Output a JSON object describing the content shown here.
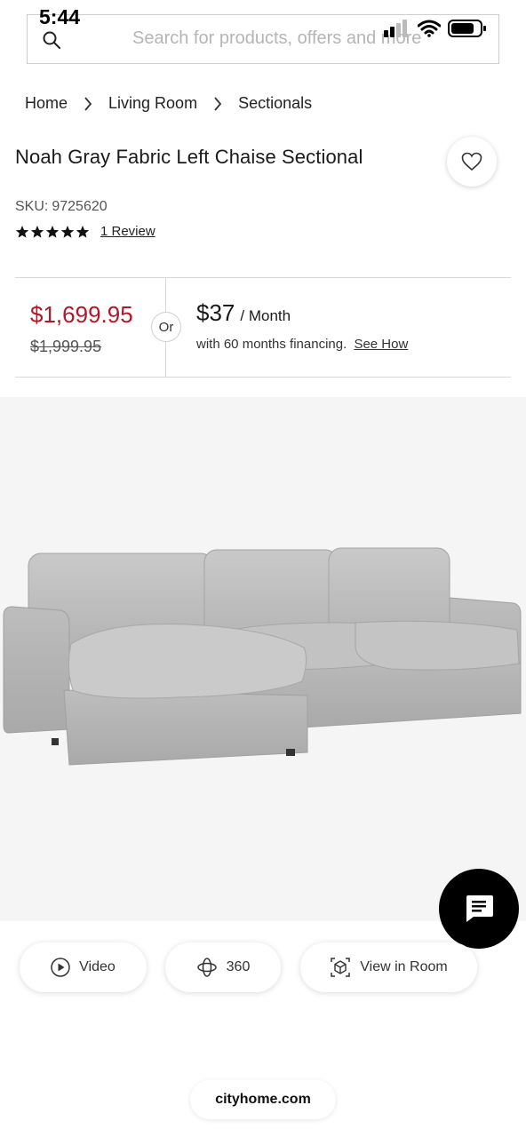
{
  "status_bar": {
    "time": "5:44"
  },
  "search": {
    "placeholder": "Search for products, offers and more"
  },
  "breadcrumb": [
    "Home",
    "Living Room",
    "Sectionals"
  ],
  "product": {
    "title": "Noah Gray Fabric Left Chaise Sectional",
    "sku_label": "SKU:",
    "sku": "9725620",
    "rating_stars": 5,
    "review_link": "1 Review"
  },
  "pricing": {
    "sale_price": "$1,699.95",
    "original_price": "$1,999.95",
    "or_label": "Or",
    "monthly_amount": "$37",
    "monthly_unit": "/ Month",
    "financing_text": "with 60 months financing.",
    "see_how": "See How",
    "sale_color": "#b2182b"
  },
  "media_buttons": {
    "video": "Video",
    "rotate": "360",
    "room": "View in Room"
  },
  "footer": {
    "domain": "cityhome.com"
  },
  "icons": [
    "search-icon",
    "chevron-right-icon",
    "heart-icon",
    "star-icon",
    "play-icon",
    "rotate-360-icon",
    "ar-cube-icon",
    "chat-icon",
    "wifi-icon",
    "battery-icon",
    "signal-icon"
  ]
}
